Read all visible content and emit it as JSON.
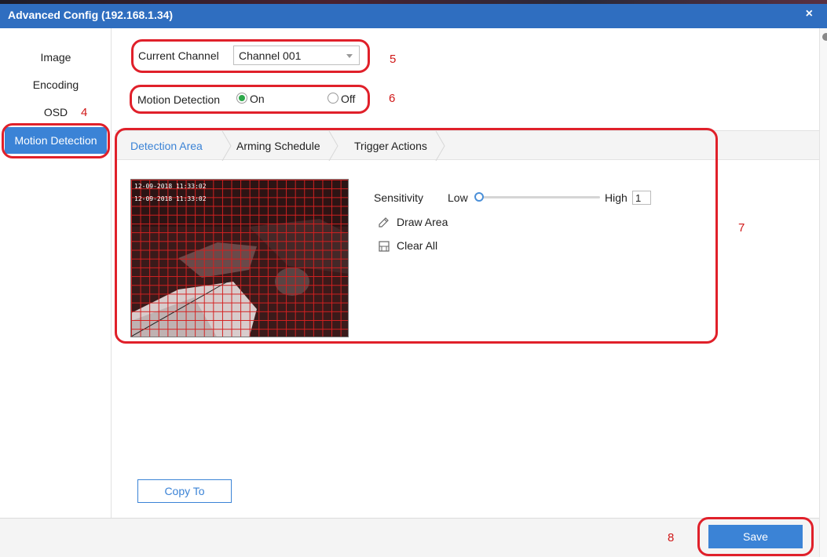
{
  "window": {
    "title": "Advanced Config (192.168.1.34)",
    "close_label": "×"
  },
  "sidebar": {
    "items": [
      {
        "label": "Image"
      },
      {
        "label": "Encoding"
      },
      {
        "label": "OSD"
      },
      {
        "label": "Motion Detection",
        "active": true
      }
    ]
  },
  "channel": {
    "label": "Current Channel",
    "value": "Channel 001"
  },
  "motion": {
    "label": "Motion Detection",
    "on_label": "On",
    "off_label": "Off",
    "selected": "On"
  },
  "tabs": [
    {
      "label": "Detection Area",
      "active": true
    },
    {
      "label": "Arming Schedule"
    },
    {
      "label": "Trigger Actions"
    }
  ],
  "preview": {
    "osd_line1": "12-09-2018 11:33:02",
    "osd_line2": "12-09-2018 11:33:02"
  },
  "sensitivity": {
    "label": "Sensitivity",
    "low_label": "Low",
    "high_label": "High",
    "value": "1",
    "level": 0.0
  },
  "actions": {
    "draw_area": "Draw Area",
    "clear_all": "Clear All"
  },
  "buttons": {
    "copy_to": "Copy To",
    "save": "Save"
  },
  "annotations": {
    "a4": "4",
    "a5": "5",
    "a6": "6",
    "a7": "7",
    "a8": "8"
  },
  "colors": {
    "accent": "#3b83d6",
    "title_bar": "#2f6ec0",
    "annotation_red": "#e0202a",
    "grid_red": "#d42020",
    "radio_on": "#2da84a"
  },
  "icons": {
    "close": "close-icon",
    "draw": "pencil-icon",
    "clear": "eraser-icon",
    "dropdown": "chevron-down-icon"
  }
}
